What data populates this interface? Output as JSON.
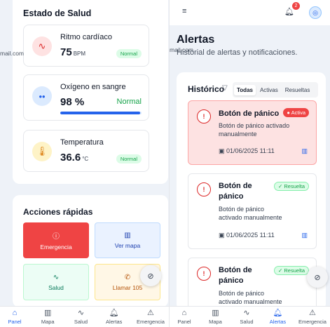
{
  "left": {
    "email_fragment": "mail.com",
    "health": {
      "title": "Estado de Salud",
      "heart": {
        "name": "Ritmo cardíaco",
        "value": "75",
        "unit": "BPM",
        "status": "Normal"
      },
      "oxygen": {
        "name": "Oxígeno en sangre",
        "value": "98 %",
        "status": "Normal",
        "level": 0.98
      },
      "temp": {
        "name": "Temperatura",
        "value": "36.6",
        "unit": "°C",
        "status": "Normal"
      }
    },
    "actions": {
      "title": "Acciones rápidas",
      "emergency": "Emergencia",
      "map": "Ver mapa",
      "health": "Salud",
      "call": "Llamar 105"
    },
    "nav": [
      "Panel",
      "Mapa",
      "Salud",
      "Alertas",
      "Emergencia"
    ]
  },
  "right": {
    "email_fragment": "mail.com",
    "notification_count": "2",
    "title": "Alertas",
    "subtitle": "Historial de alertas y notificaciones.",
    "history": {
      "title": "Histórico",
      "tabs": [
        "Todas",
        "Activas",
        "Resueltas"
      ],
      "alerts": [
        {
          "title": "Botón de pánico",
          "status": "Activa",
          "description": "Botón de pánico activado manualmente",
          "date": "01/06/2025 11:11"
        },
        {
          "title": "Botón de pánico",
          "status": "Resuelta",
          "description": "Botón de pánico activado manualmente",
          "date": "01/06/2025 11:11"
        },
        {
          "title": "Botón de pánico",
          "status": "Resuelta",
          "description": "Botón de pánico activado manualmente"
        }
      ]
    },
    "nav": [
      "Panel",
      "Mapa",
      "Salud",
      "Alertas",
      "Emergencia"
    ]
  },
  "colors": {
    "accent": "#2563eb",
    "danger": "#ef4444",
    "success": "#16a34a",
    "background": "#eef2f8"
  },
  "icons": {
    "heart": "heart-pulse-icon",
    "oxygen": "droplets-icon",
    "temp": "thermometer-icon",
    "bell": "bell-icon",
    "mute": "mic-off-icon"
  }
}
